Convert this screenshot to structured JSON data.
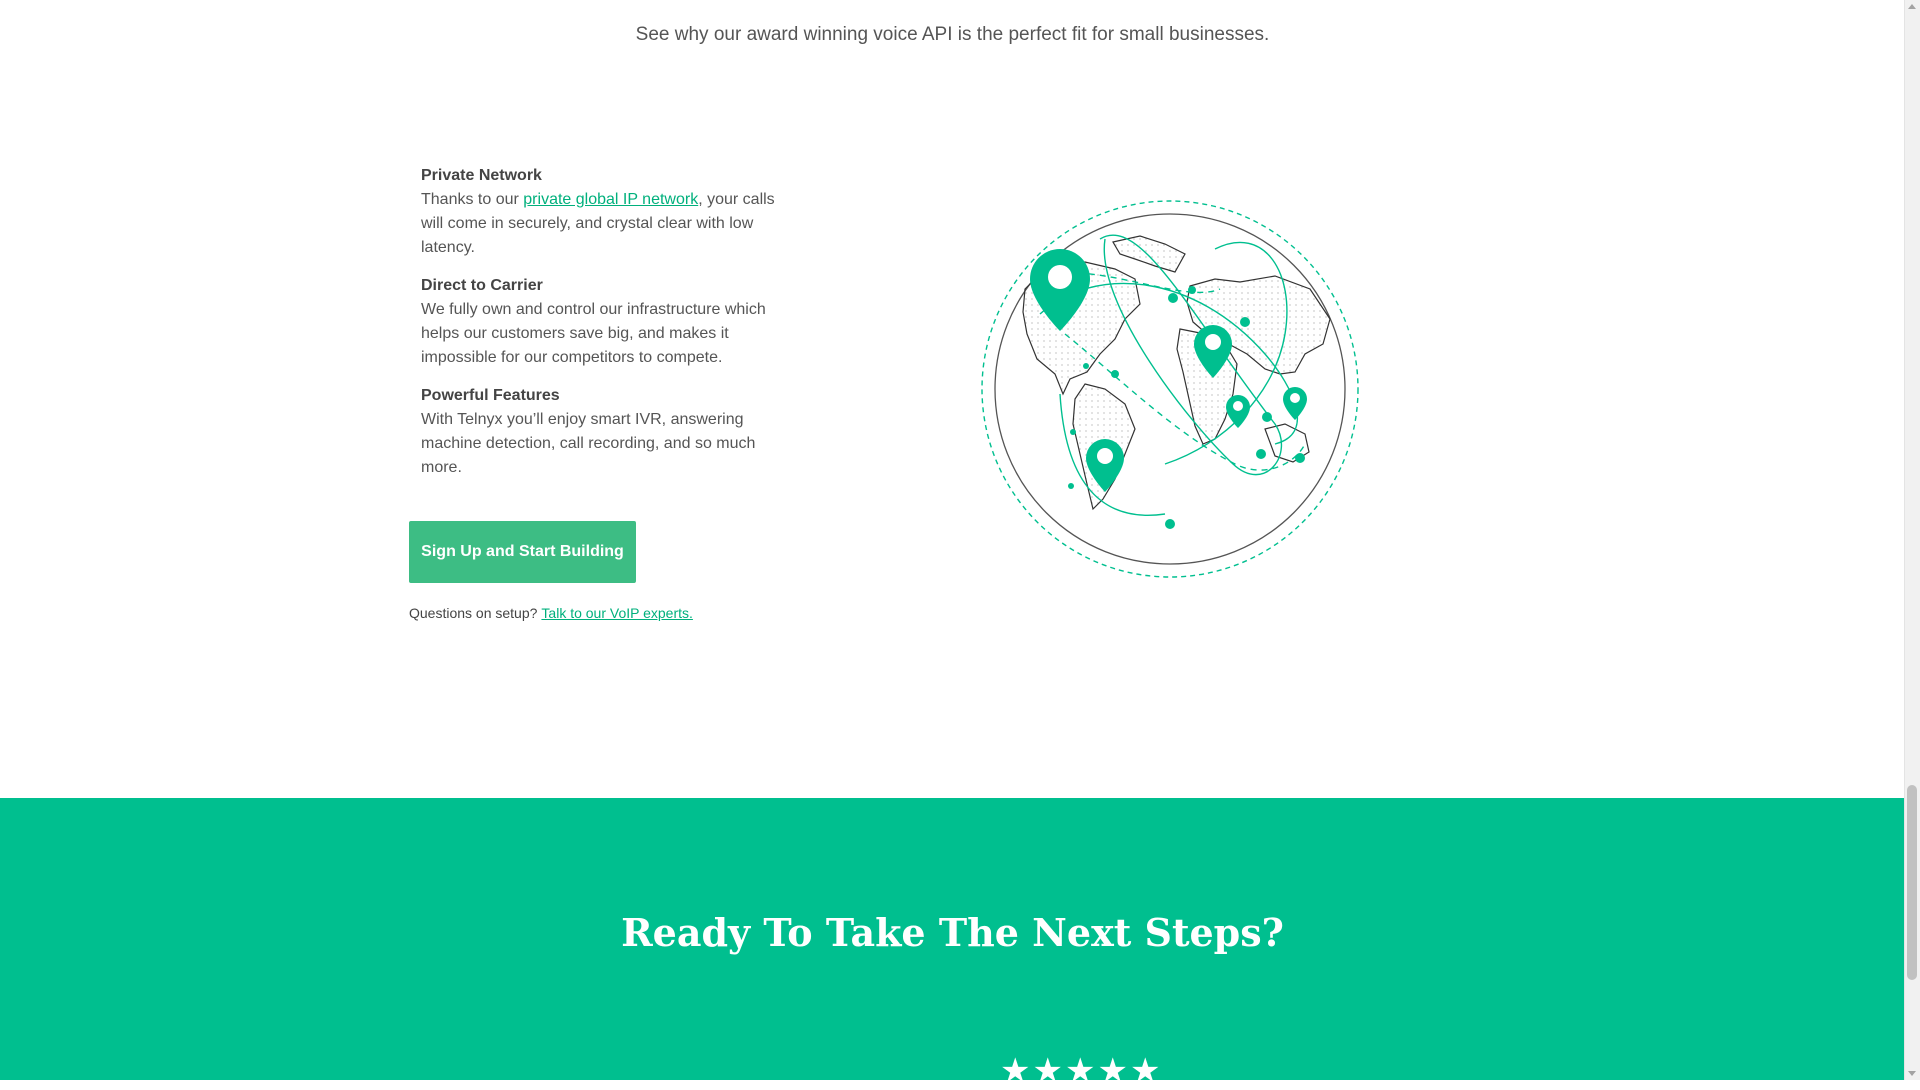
{
  "intro": {
    "text": "See why our award winning voice API is the perfect fit for small businesses."
  },
  "features": [
    {
      "title": "Private Network",
      "text_before": "Thanks to our ",
      "link": "private global IP network",
      "text_after": ", your calls will come in securely, and crystal clear with low latency."
    },
    {
      "title": "Direct to Carrier",
      "text": "We fully own and control our infrastructure which helps our customers save big, and makes it impossible for our competitors to compete."
    },
    {
      "title": "Powerful Features",
      "text": "With Telnyx you’ll enjoy smart IVR, answering machine detection, call recording, and so much more."
    }
  ],
  "cta": {
    "button_label": "Sign Up and Start Building",
    "question": "Questions on setup?",
    "link": "Talk to our VoIP experts."
  },
  "band": {
    "title": "Ready To Take The Next Steps?",
    "rating_stars": 5
  },
  "colors": {
    "accent": "#00bf8f",
    "button": "#3dbd84",
    "link": "#00b07c"
  },
  "icons": [
    "globe-illustration",
    "location-pin-icon",
    "star-icon"
  ]
}
